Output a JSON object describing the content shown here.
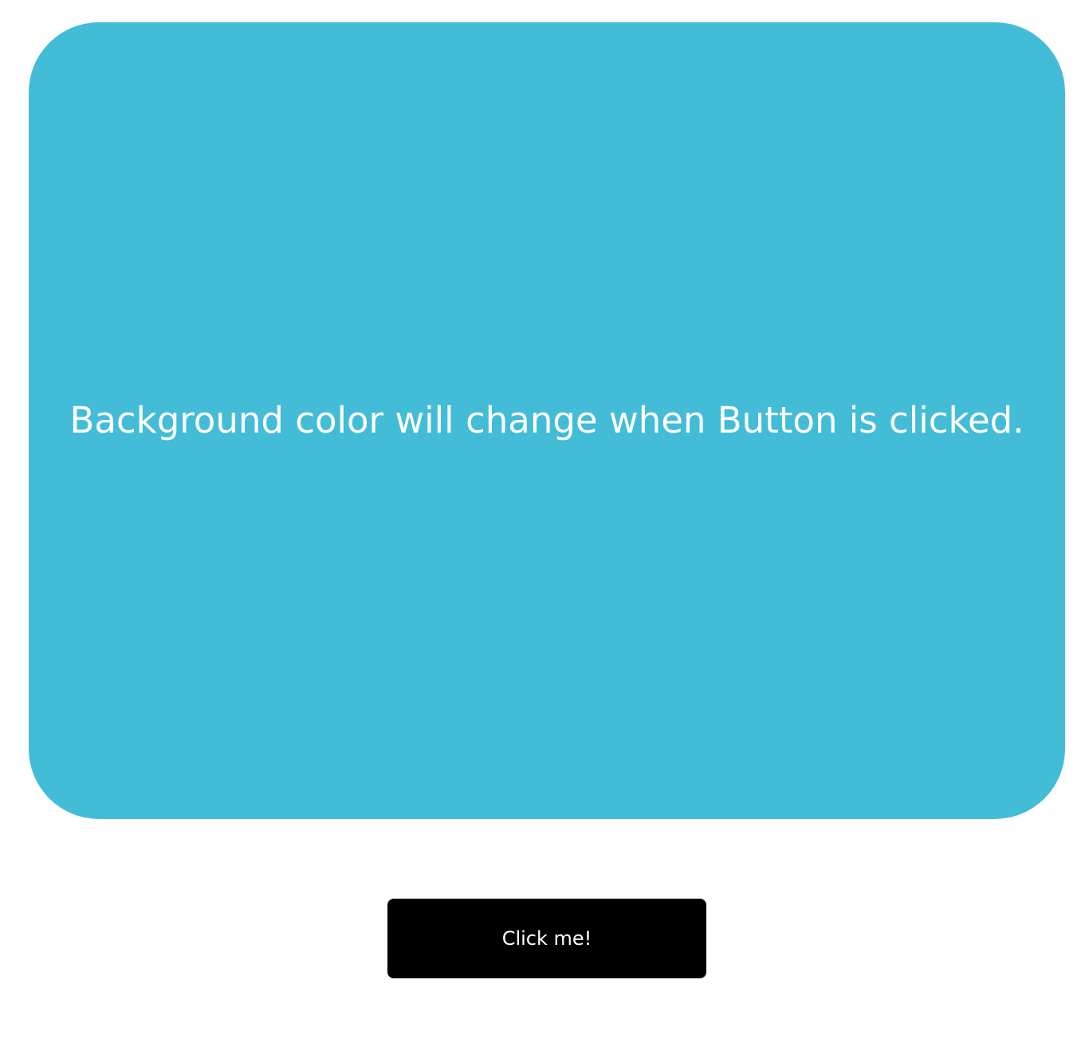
{
  "panel": {
    "message": "Background color will change when Button is clicked.",
    "background_color": "#42bcd7",
    "text_color": "#ffffff"
  },
  "button": {
    "label": "Click me!",
    "background_color": "#000000",
    "text_color": "#ffffff"
  }
}
